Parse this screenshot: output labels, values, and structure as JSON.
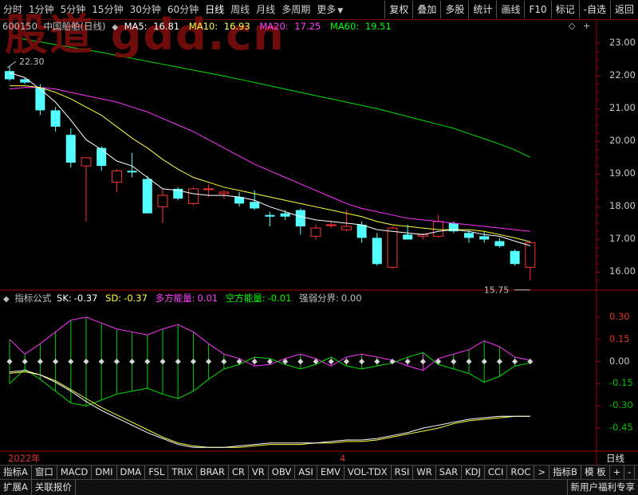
{
  "timeframes": [
    "分时",
    "1分钟",
    "5分钟",
    "15分钟",
    "30分钟",
    "60分钟",
    "日线",
    "周线",
    "月线",
    "多周期",
    "更多"
  ],
  "active_timeframe": "日线",
  "toolbar_buttons": [
    "复权",
    "叠加",
    "多股",
    "统计",
    "画线",
    "F10",
    "标记",
    "-自选",
    "返回"
  ],
  "watermark": "股道 gdd.cn",
  "stock": {
    "code": "600150",
    "name": "中国船舶(日线)"
  },
  "ma": [
    {
      "label": "MA5:",
      "value": "16.81",
      "color": "#ffffff"
    },
    {
      "label": "MA10:",
      "value": "16.93",
      "color": "#ffff40"
    },
    {
      "label": "MA20:",
      "value": "17.25",
      "color": "#ff40ff"
    },
    {
      "label": "MA60:",
      "value": "19.51",
      "color": "#00ff00"
    }
  ],
  "price_axis": [
    "23.00",
    "22.00",
    "21.00",
    "20.00",
    "19.00",
    "18.00",
    "17.00",
    "16.00"
  ],
  "price_ylim": [
    15.5,
    23.3
  ],
  "high_marker": "22.30",
  "low_marker": "15.75",
  "candles": [
    {
      "o": 22.15,
      "h": 22.3,
      "l": 21.85,
      "c": 21.9
    },
    {
      "o": 21.9,
      "h": 21.95,
      "l": 21.75,
      "c": 21.8
    },
    {
      "o": 21.65,
      "h": 21.75,
      "l": 20.8,
      "c": 20.95
    },
    {
      "o": 20.95,
      "h": 21.05,
      "l": 20.3,
      "c": 20.45
    },
    {
      "o": 20.2,
      "h": 20.4,
      "l": 19.2,
      "c": 19.35
    },
    {
      "o": 19.25,
      "h": 19.5,
      "l": 17.55,
      "c": 19.5
    },
    {
      "o": 19.8,
      "h": 19.85,
      "l": 19.1,
      "c": 19.25
    },
    {
      "o": 18.75,
      "h": 19.15,
      "l": 18.45,
      "c": 19.1
    },
    {
      "o": 19.1,
      "h": 19.65,
      "l": 18.9,
      "c": 19.05
    },
    {
      "o": 18.85,
      "h": 18.95,
      "l": 17.8,
      "c": 17.8
    },
    {
      "o": 18.0,
      "h": 18.55,
      "l": 17.5,
      "c": 18.35
    },
    {
      "o": 18.55,
      "h": 18.6,
      "l": 18.2,
      "c": 18.25
    },
    {
      "o": 18.1,
      "h": 18.6,
      "l": 18.05,
      "c": 18.55
    },
    {
      "o": 18.55,
      "h": 18.7,
      "l": 18.3,
      "c": 18.55
    },
    {
      "o": 18.4,
      "h": 18.5,
      "l": 18.25,
      "c": 18.45
    },
    {
      "o": 18.3,
      "h": 18.45,
      "l": 18.0,
      "c": 18.1
    },
    {
      "o": 18.15,
      "h": 18.5,
      "l": 17.9,
      "c": 17.95
    },
    {
      "o": 17.75,
      "h": 17.85,
      "l": 17.4,
      "c": 17.7
    },
    {
      "o": 17.8,
      "h": 17.9,
      "l": 17.6,
      "c": 17.7
    },
    {
      "o": 17.9,
      "h": 17.95,
      "l": 17.15,
      "c": 17.4
    },
    {
      "o": 17.1,
      "h": 17.45,
      "l": 17.0,
      "c": 17.35
    },
    {
      "o": 17.45,
      "h": 17.55,
      "l": 17.35,
      "c": 17.45
    },
    {
      "o": 17.3,
      "h": 17.9,
      "l": 17.25,
      "c": 17.4
    },
    {
      "o": 17.45,
      "h": 17.55,
      "l": 16.9,
      "c": 17.05
    },
    {
      "o": 17.05,
      "h": 17.2,
      "l": 16.2,
      "c": 16.25
    },
    {
      "o": 16.15,
      "h": 17.4,
      "l": 16.1,
      "c": 17.35
    },
    {
      "o": 17.15,
      "h": 17.45,
      "l": 17.0,
      "c": 17.0
    },
    {
      "o": 17.1,
      "h": 17.2,
      "l": 17.0,
      "c": 17.15
    },
    {
      "o": 17.1,
      "h": 17.75,
      "l": 17.05,
      "c": 17.55
    },
    {
      "o": 17.5,
      "h": 17.55,
      "l": 17.2,
      "c": 17.25
    },
    {
      "o": 17.2,
      "h": 17.3,
      "l": 16.9,
      "c": 17.05
    },
    {
      "o": 17.1,
      "h": 17.25,
      "l": 16.9,
      "c": 17.0
    },
    {
      "o": 16.95,
      "h": 17.05,
      "l": 16.75,
      "c": 16.8
    },
    {
      "o": 16.65,
      "h": 16.7,
      "l": 16.2,
      "c": 16.25
    },
    {
      "o": 16.15,
      "h": 16.95,
      "l": 15.75,
      "c": 16.9
    }
  ],
  "ma5": [
    22.1,
    21.95,
    21.6,
    21.2,
    20.65,
    20.05,
    19.75,
    19.4,
    19.25,
    18.9,
    18.55,
    18.5,
    18.4,
    18.35,
    18.35,
    18.3,
    18.2,
    18.0,
    17.85,
    17.7,
    17.6,
    17.55,
    17.5,
    17.45,
    17.3,
    17.25,
    17.2,
    17.15,
    17.25,
    17.3,
    17.25,
    17.15,
    17.1,
    16.95,
    16.81
  ],
  "ma10": [
    21.7,
    21.7,
    21.65,
    21.5,
    21.3,
    21.05,
    20.8,
    20.45,
    20.1,
    19.8,
    19.45,
    19.15,
    18.9,
    18.75,
    18.6,
    18.5,
    18.4,
    18.3,
    18.2,
    18.1,
    18.0,
    17.9,
    17.8,
    17.7,
    17.55,
    17.45,
    17.4,
    17.35,
    17.3,
    17.3,
    17.3,
    17.25,
    17.15,
    17.05,
    16.93
  ],
  "ma20": [
    21.6,
    21.65,
    21.65,
    21.6,
    21.5,
    21.4,
    21.3,
    21.2,
    21.05,
    20.9,
    20.7,
    20.5,
    20.3,
    20.05,
    19.8,
    19.55,
    19.3,
    19.1,
    18.9,
    18.7,
    18.5,
    18.3,
    18.1,
    17.95,
    17.85,
    17.75,
    17.65,
    17.6,
    17.55,
    17.5,
    17.45,
    17.4,
    17.35,
    17.3,
    17.25
  ],
  "ma60": [
    23.2,
    23.12,
    23.04,
    22.96,
    22.88,
    22.8,
    22.72,
    22.63,
    22.54,
    22.45,
    22.36,
    22.27,
    22.18,
    22.09,
    22.0,
    21.9,
    21.8,
    21.7,
    21.6,
    21.5,
    21.4,
    21.3,
    21.2,
    21.1,
    21.0,
    20.88,
    20.76,
    20.64,
    20.52,
    20.4,
    20.24,
    20.08,
    19.92,
    19.74,
    19.51
  ],
  "indicator": {
    "name": "指标公式",
    "items": [
      {
        "label": "SK:",
        "value": "-0.37",
        "color": "#ffffff"
      },
      {
        "label": "SD:",
        "value": "-0.37",
        "color": "#ffff40"
      },
      {
        "label": "多方能量:",
        "value": "0.01",
        "color": "#ff40ff"
      },
      {
        "label": "空方能量:",
        "value": "-0.01",
        "color": "#00ff00"
      },
      {
        "label": "强弱分界:",
        "value": "0.00",
        "color": "#c0c0c0"
      }
    ],
    "axis": [
      "0.30",
      "0.15",
      "0.00",
      "-0.15",
      "-0.30",
      "-0.45"
    ],
    "ylim": [
      -0.6,
      0.38
    ],
    "energy": [
      0.15,
      0.05,
      0.12,
      0.2,
      0.28,
      0.3,
      0.26,
      0.22,
      0.2,
      0.18,
      0.22,
      0.25,
      0.2,
      0.12,
      0.05,
      0.02,
      -0.03,
      -0.02,
      0.02,
      0.05,
      0.02,
      -0.03,
      0.03,
      0.05,
      0.03,
      0.01,
      -0.03,
      -0.06,
      0.02,
      0.05,
      0.08,
      0.14,
      0.1,
      0.03,
      0.01
    ],
    "sk": [
      -0.07,
      -0.06,
      -0.09,
      -0.14,
      -0.2,
      -0.27,
      -0.33,
      -0.38,
      -0.43,
      -0.48,
      -0.52,
      -0.56,
      -0.58,
      -0.58,
      -0.58,
      -0.57,
      -0.56,
      -0.55,
      -0.55,
      -0.55,
      -0.55,
      -0.54,
      -0.53,
      -0.53,
      -0.52,
      -0.5,
      -0.48,
      -0.45,
      -0.43,
      -0.41,
      -0.39,
      -0.38,
      -0.37,
      -0.37,
      -0.37
    ],
    "sd": [
      -0.08,
      -0.07,
      -0.09,
      -0.13,
      -0.19,
      -0.25,
      -0.31,
      -0.36,
      -0.41,
      -0.46,
      -0.51,
      -0.55,
      -0.57,
      -0.58,
      -0.58,
      -0.58,
      -0.57,
      -0.56,
      -0.56,
      -0.56,
      -0.55,
      -0.55,
      -0.54,
      -0.54,
      -0.53,
      -0.51,
      -0.49,
      -0.47,
      -0.45,
      -0.42,
      -0.4,
      -0.39,
      -0.38,
      -0.37,
      -0.37
    ]
  },
  "dates": {
    "year": "2022年",
    "month": "4",
    "period": "日线"
  },
  "indicator_tabs": [
    "指标A",
    "窗口",
    "MACD",
    "DMI",
    "DMA",
    "FSL",
    "TRIX",
    "BRAR",
    "CR",
    "VR",
    "OBV",
    "ASI",
    "EMV",
    "VOL-TDX",
    "RSI",
    "WR",
    "SAR",
    "KDJ",
    "CCI",
    "ROC",
    ">",
    "指标B",
    "模 板",
    "+",
    "-"
  ],
  "status_bar": [
    "扩展A",
    "关联报价"
  ],
  "promo": "新用户福利专享"
}
